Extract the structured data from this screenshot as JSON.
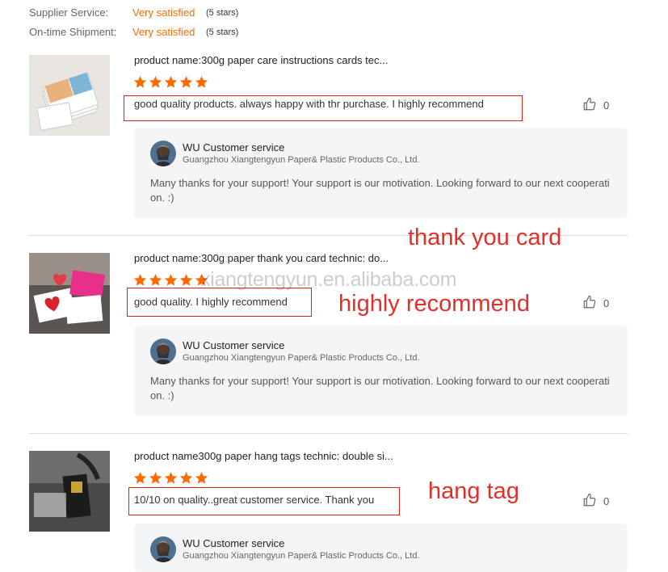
{
  "summary": [
    {
      "label": "Supplier Service:",
      "value": "Very satisfied",
      "note": "(5 stars)"
    },
    {
      "label": "On-time Shipment:",
      "value": "Very satisfied",
      "note": "(5 stars)"
    }
  ],
  "colors": {
    "star": "#ff6a00",
    "annotation": "#e0302a",
    "accent": "#ff6a00"
  },
  "reviews": [
    {
      "product_name": "product name:300g paper care instructions cards tec...",
      "rating": 5,
      "comment": "good quality products. always happy with thr purchase. I highly recommend",
      "likes": "0",
      "reply": {
        "name": "WU Customer service",
        "company": "Guangzhou Xiangtengyun Paper& Plastic Products Co., Ltd.",
        "text": "Many thanks for your support! Your support is our motivation. Looking forward to our next cooperation. :)"
      }
    },
    {
      "product_name": "product name:300g paper thank you card technic: do...",
      "rating": 5,
      "comment": "good quality. I highly recommend",
      "likes": "0",
      "reply": {
        "name": "WU Customer service",
        "company": "Guangzhou Xiangtengyun Paper& Plastic Products Co., Ltd.",
        "text": "Many thanks for your support! Your support is our motivation. Looking forward to our next cooperation. :)"
      }
    },
    {
      "product_name": "product name300g paper hang tags technic: double si...",
      "rating": 5,
      "comment": "10/10 on quality..great customer service.  Thank you",
      "likes": "0",
      "reply": {
        "name": "WU Customer service",
        "company": "Guangzhou Xiangtengyun Paper& Plastic Products Co., Ltd.",
        "text": ""
      }
    }
  ],
  "annotations": {
    "thank_you_card": "thank you card",
    "highly_recommend": "highly recommend",
    "hang_tag": "hang tag"
  },
  "watermark": "xiangtengyun.en.alibaba.com"
}
